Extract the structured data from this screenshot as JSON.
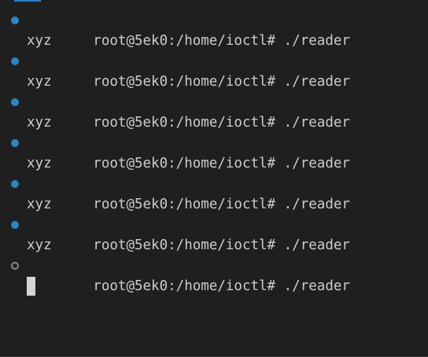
{
  "terminal": {
    "blocks": [
      {
        "prompt": "root@5ek0:/home/ioctl#",
        "command": "./reader",
        "output": "xyz",
        "status": "success"
      },
      {
        "prompt": "root@5ek0:/home/ioctl#",
        "command": "./reader",
        "output": "xyz",
        "status": "success"
      },
      {
        "prompt": "root@5ek0:/home/ioctl#",
        "command": "./reader",
        "output": "xyz",
        "status": "success"
      },
      {
        "prompt": "root@5ek0:/home/ioctl#",
        "command": "./reader",
        "output": "xyz",
        "status": "success"
      },
      {
        "prompt": "root@5ek0:/home/ioctl#",
        "command": "./reader",
        "output": "xyz",
        "status": "success"
      },
      {
        "prompt": "root@5ek0:/home/ioctl#",
        "command": "./reader",
        "output": "xyz",
        "status": "success"
      },
      {
        "prompt": "root@5ek0:/home/ioctl#",
        "command": "./reader",
        "output": "",
        "status": "running"
      }
    ]
  },
  "colors": {
    "background": "#1f1f1f",
    "text": "#cccccc",
    "success_marker": "#2f85c1",
    "running_marker": "#8a8a8a",
    "cursor": "#d4d4d4"
  },
  "icons": {
    "success": "command-success-decoration-icon",
    "running": "command-running-decoration-icon"
  }
}
